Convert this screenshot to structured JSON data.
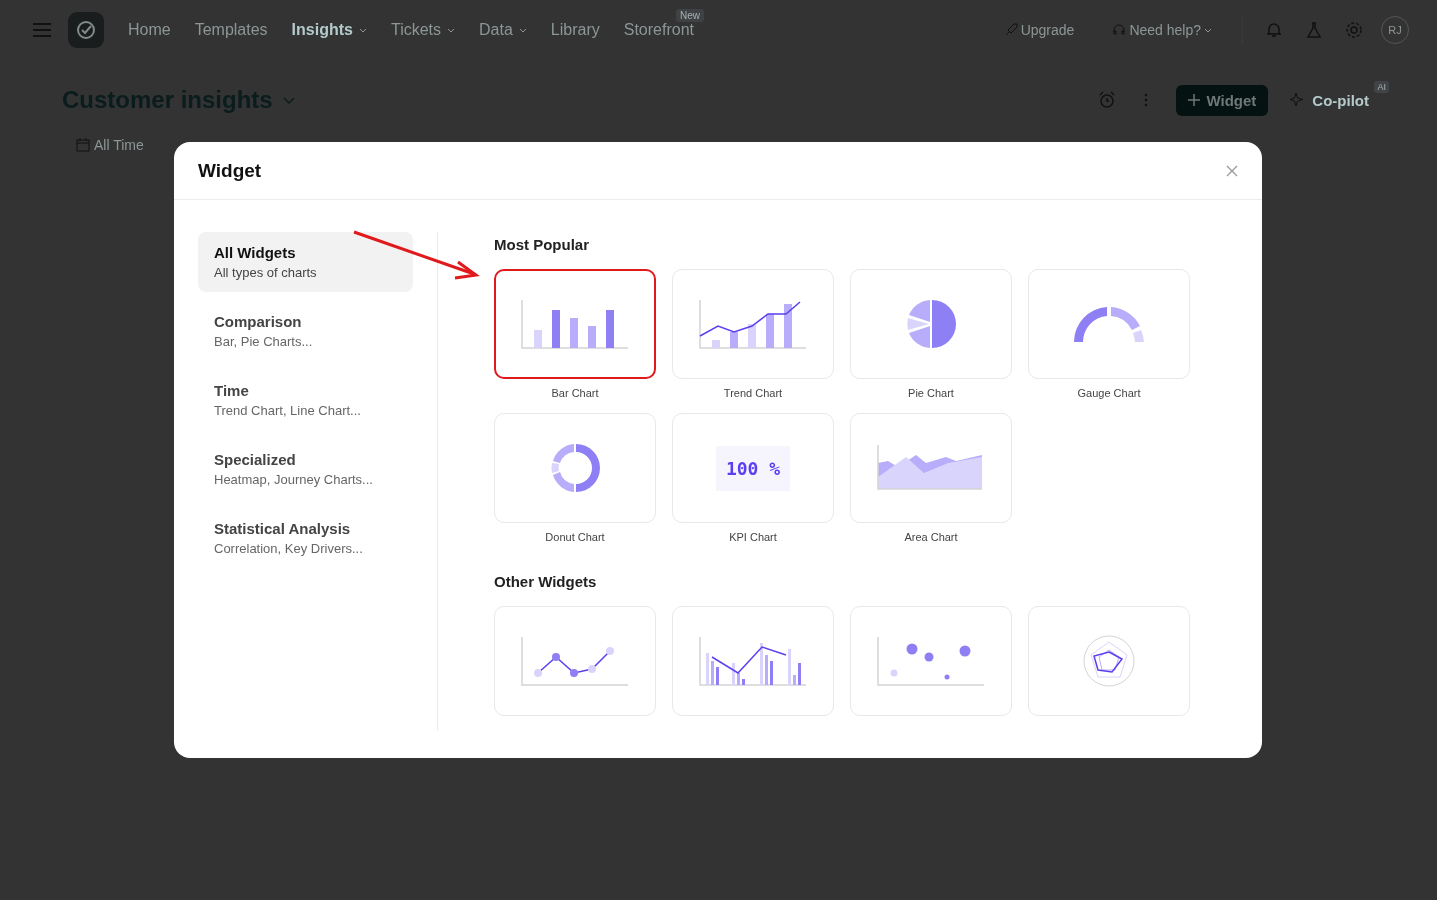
{
  "nav": {
    "items": [
      {
        "label": "Home",
        "selected": false,
        "dropdown": false
      },
      {
        "label": "Templates",
        "selected": false,
        "dropdown": false
      },
      {
        "label": "Insights",
        "selected": true,
        "dropdown": true
      },
      {
        "label": "Tickets",
        "selected": false,
        "dropdown": true
      },
      {
        "label": "Data",
        "selected": false,
        "dropdown": true
      },
      {
        "label": "Library",
        "selected": false,
        "dropdown": false
      },
      {
        "label": "Storefront",
        "selected": false,
        "dropdown": false,
        "badge": "New"
      }
    ],
    "upgrade": "Upgrade",
    "help": "Need help?",
    "avatar": "RJ"
  },
  "page": {
    "title": "Customer insights",
    "filter": "All Time",
    "widget_button": "Widget",
    "copilot": "Co-pilot",
    "copilot_badge": "AI"
  },
  "modal": {
    "title": "Widget",
    "categories": [
      {
        "title": "All Widgets",
        "subtitle": "All types of charts",
        "selected": true
      },
      {
        "title": "Comparison",
        "subtitle": "Bar, Pie Charts...",
        "selected": false
      },
      {
        "title": "Time",
        "subtitle": "Trend Chart, Line Chart...",
        "selected": false
      },
      {
        "title": "Specialized",
        "subtitle": "Heatmap, Journey Charts...",
        "selected": false
      },
      {
        "title": "Statistical Analysis",
        "subtitle": "Correlation, Key Drivers...",
        "selected": false
      }
    ],
    "sections": [
      {
        "title": "Most Popular",
        "widgets": [
          {
            "kind": "bar",
            "label": "Bar Chart",
            "selected": true
          },
          {
            "kind": "trend",
            "label": "Trend Chart",
            "selected": false
          },
          {
            "kind": "pie",
            "label": "Pie Chart",
            "selected": false
          },
          {
            "kind": "gauge",
            "label": "Gauge Chart",
            "selected": false
          },
          {
            "kind": "donut",
            "label": "Donut Chart",
            "selected": false
          },
          {
            "kind": "kpi",
            "label": "KPI Chart",
            "value": "100 %",
            "selected": false
          },
          {
            "kind": "area",
            "label": "Area Chart",
            "selected": false
          }
        ]
      },
      {
        "title": "Other Widgets",
        "widgets": [
          {
            "kind": "line",
            "selected": false
          },
          {
            "kind": "combo",
            "selected": false
          },
          {
            "kind": "scatter",
            "selected": false
          },
          {
            "kind": "radar",
            "selected": false
          }
        ]
      }
    ]
  }
}
